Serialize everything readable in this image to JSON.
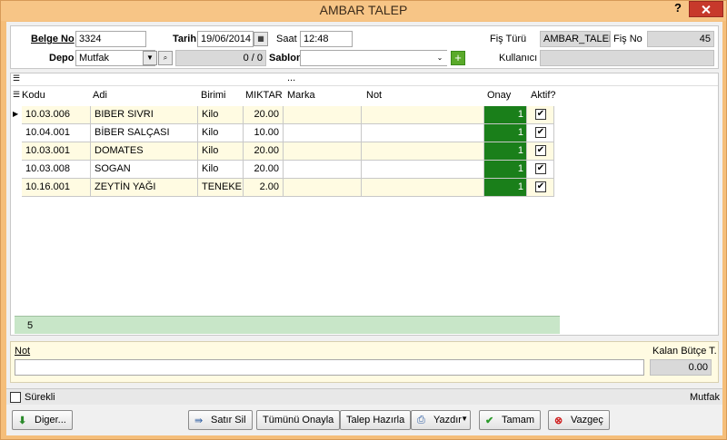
{
  "window": {
    "title": "AMBAR TALEP",
    "help": "?"
  },
  "header": {
    "belge_no_label": "Belge No",
    "belge_no": "3324",
    "tarih_label": "Tarih",
    "tarih": "19/06/2014",
    "saat_label": "Saat",
    "saat": "12:48",
    "fis_turu_label": "Fiş Türü",
    "fis_turu": "AMBAR_TALEP",
    "fis_no_label": "Fiş No",
    "fis_no": "45",
    "depo_label": "Depo",
    "depo": "Mutfak",
    "counter": "0 / 0",
    "sablon_label": "Sablon",
    "sablon": "",
    "kullanici_label": "Kullanıcı",
    "kullanici": ""
  },
  "grid": {
    "top_marker": "...",
    "columns": [
      "Kodu",
      "Adi",
      "Birimi",
      "MIKTAR",
      "Marka",
      "Not",
      "Onay",
      "Aktif?"
    ],
    "rows": [
      {
        "kodu": "10.03.006",
        "adi": "BIBER SIVRI",
        "birimi": "Kilo",
        "miktar": "20.00",
        "marka": "",
        "not": "",
        "onay": "1",
        "aktif": "✔"
      },
      {
        "kodu": "10.04.001",
        "adi": "BİBER SALÇASI",
        "birimi": "Kilo",
        "miktar": "10.00",
        "marka": "",
        "not": "",
        "onay": "1",
        "aktif": "✔"
      },
      {
        "kodu": "10.03.001",
        "adi": "DOMATES",
        "birimi": "Kilo",
        "miktar": "20.00",
        "marka": "",
        "not": "",
        "onay": "1",
        "aktif": "✔"
      },
      {
        "kodu": "10.03.008",
        "adi": "SOGAN",
        "birimi": "Kilo",
        "miktar": "20.00",
        "marka": "",
        "not": "",
        "onay": "1",
        "aktif": "✔"
      },
      {
        "kodu": "10.16.001",
        "adi": "ZEYTİN YAĞI",
        "birimi": "TENEKE",
        "miktar": "2.00",
        "marka": "",
        "not": "",
        "onay": "1",
        "aktif": "✔"
      }
    ],
    "row_count": "5"
  },
  "not_section": {
    "label": "Not",
    "value": "",
    "kalan_label": "Kalan Bütçe T.",
    "kalan_value": "0.00"
  },
  "status": {
    "surekli_label": "Sürekli",
    "depo_name": "Mutfak"
  },
  "buttons": {
    "diger": "Diger...",
    "satir_sil": "Satır Sil",
    "tumunu_onayla": "Tümünü Onayla",
    "talep_hazirla": "Talep Hazırla",
    "yazdir": "Yazdır",
    "tamam": "Tamam",
    "vazgec": "Vazgeç"
  }
}
